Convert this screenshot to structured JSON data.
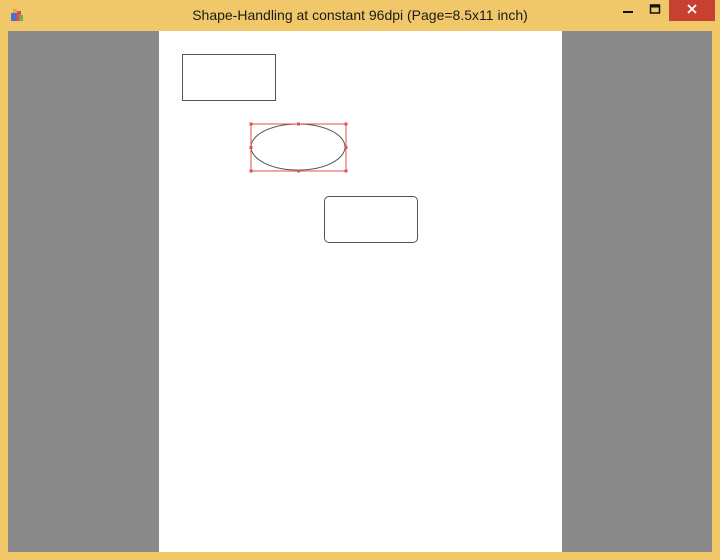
{
  "window": {
    "title": "Shape-Handling at constant 96dpi (Page=8.5x11 inch)",
    "icons": {
      "app": "app-icon",
      "minimize": "minimize-icon",
      "maximize": "maximize-icon",
      "close": "close-icon"
    },
    "colors": {
      "frame": "#f0c86a",
      "close_button": "#c84031",
      "workspace": "#898989",
      "page": "#ffffff",
      "selection": "#e0524a"
    }
  },
  "canvas": {
    "shapes": [
      {
        "type": "rectangle",
        "selected": false
      },
      {
        "type": "ellipse",
        "selected": true
      },
      {
        "type": "rounded-rectangle",
        "selected": false
      }
    ]
  }
}
